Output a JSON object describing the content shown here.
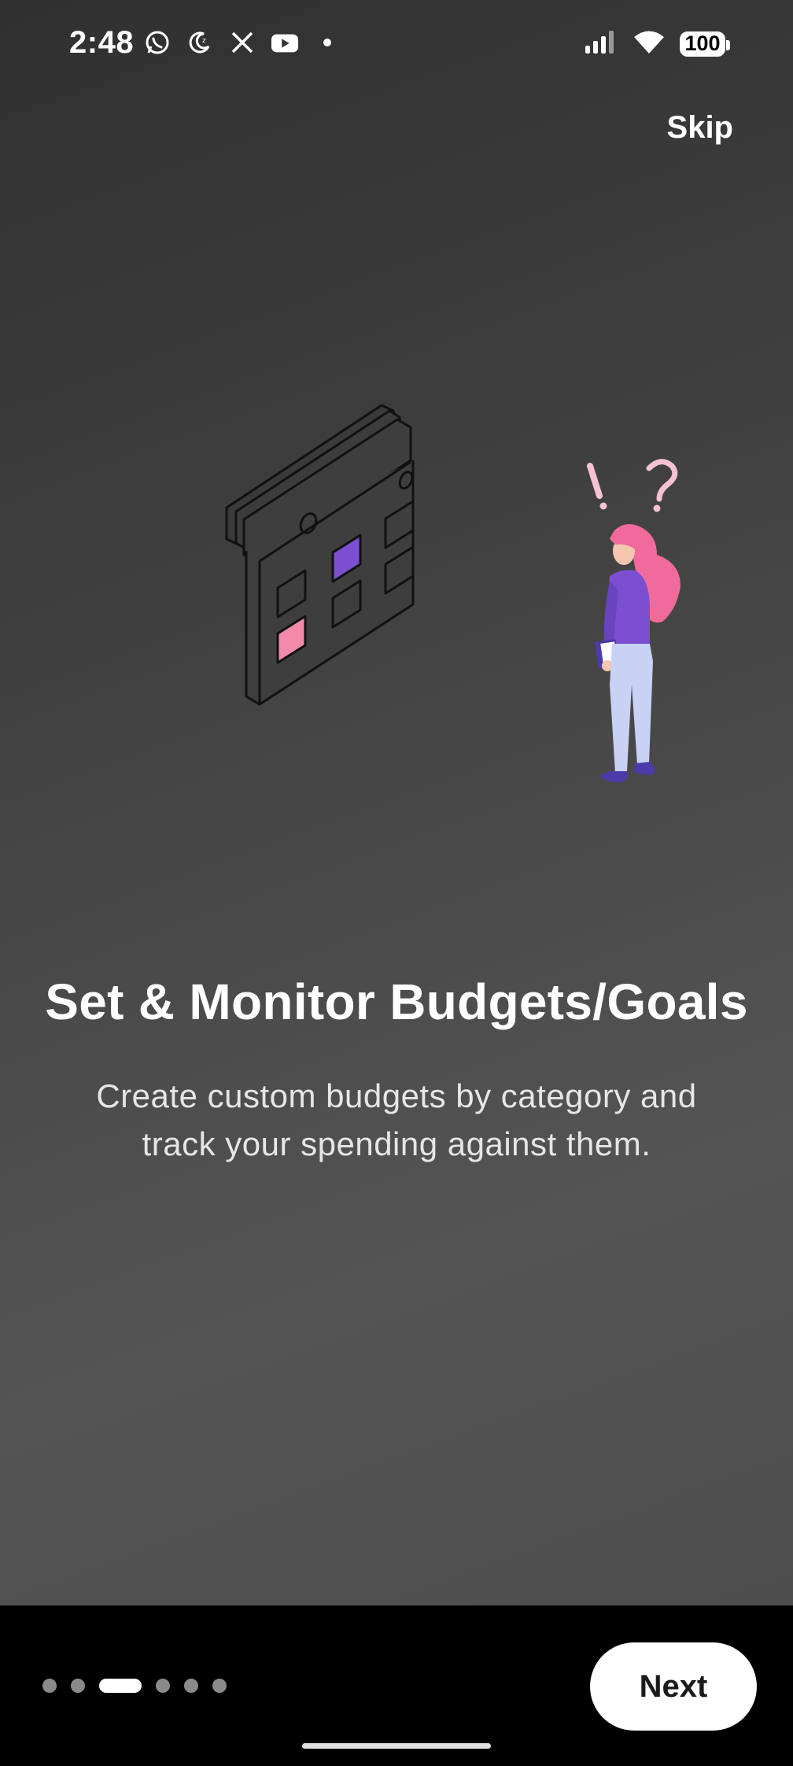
{
  "status_bar": {
    "time": "2:48",
    "battery": "100",
    "left_icons": [
      "whatsapp-icon",
      "moon-icon",
      "x-icon",
      "youtube-icon",
      "dot-icon"
    ],
    "right_icons": [
      "signal-icon",
      "wifi-icon",
      "battery-icon"
    ]
  },
  "header": {
    "skip_label": "Skip"
  },
  "onboarding": {
    "title": "Set & Monitor Budgets/Goals",
    "description": "Create custom budgets by category and track your spending against them.",
    "illustration": "calendar-and-person-illustration"
  },
  "pagination": {
    "total": 6,
    "current": 3
  },
  "footer": {
    "next_label": "Next"
  },
  "colors": {
    "accent_pink": "#F06A9B",
    "accent_purple": "#7B4FD0",
    "pants_blue": "#C7D2F5",
    "background_dark": "#3D3D3D",
    "bottom_bar": "#000000"
  }
}
